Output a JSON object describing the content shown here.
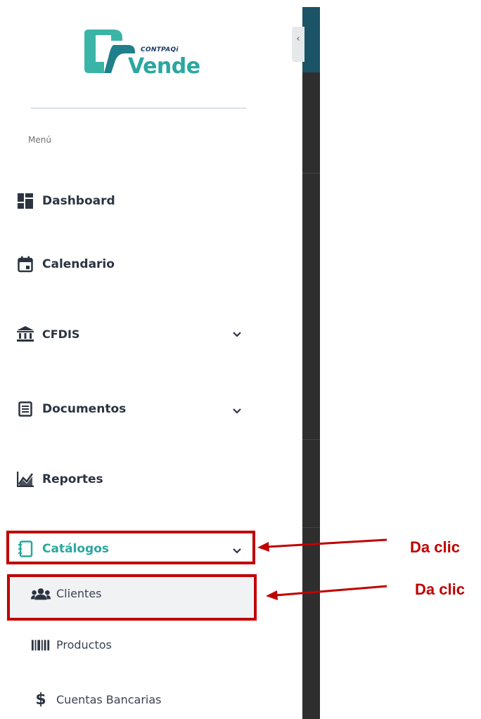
{
  "logo": {
    "brand_small": "CONTPAQi",
    "brand_big": "Vende"
  },
  "sidebar": {
    "menu_label": "Menú",
    "items": [
      {
        "label": "Dashboard",
        "icon": "dashboard-icon"
      },
      {
        "label": "Calendario",
        "icon": "calendar-icon"
      },
      {
        "label": "CFDIS",
        "icon": "bank-icon",
        "expandable": true
      },
      {
        "label": "Documentos",
        "icon": "document-icon",
        "expandable": true
      },
      {
        "label": "Reportes",
        "icon": "chart-icon"
      },
      {
        "label": "Catálogos",
        "icon": "catalog-icon",
        "expandable": true,
        "active": true
      }
    ],
    "subitems": [
      {
        "label": "Clientes",
        "icon": "users-icon",
        "selected": true
      },
      {
        "label": "Productos",
        "icon": "barcode-icon"
      },
      {
        "label": "Cuentas Bancarias",
        "icon": "dollar-icon"
      }
    ]
  },
  "annotations": {
    "first": "Da clic",
    "second": "Da clic"
  },
  "colors": {
    "accent": "#2aa7a0",
    "annotation": "#c00000",
    "text": "#2b3440"
  }
}
